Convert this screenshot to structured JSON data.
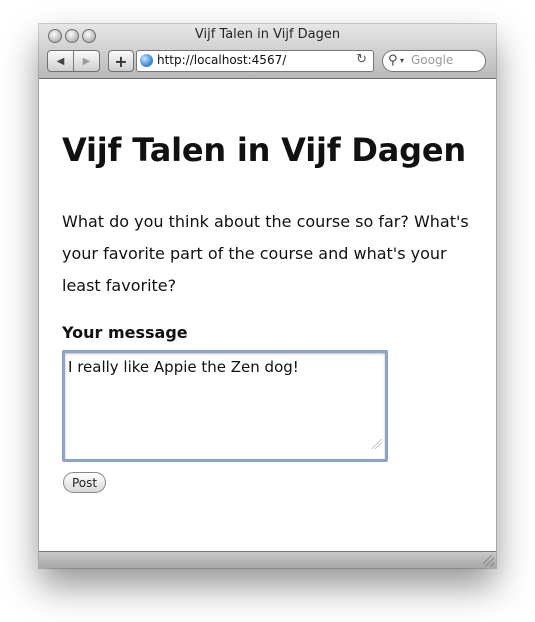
{
  "window": {
    "title": "Vijf Talen in Vijf Dagen"
  },
  "toolbar": {
    "back_icon": "◀",
    "forward_icon": "▶",
    "add_icon": "+",
    "url": "http://localhost:4567/",
    "reload_icon": "↻",
    "search_placeholder": "Google",
    "search_icon": "⚲",
    "search_caret": "▾"
  },
  "page": {
    "heading": "Vijf Talen in Vijf Dagen",
    "intro": "What do you think about the course so far? What's your favorite part of the course and what's your least favorite?",
    "message_label": "Your message",
    "message_value": "I really like Appie the Zen dog!",
    "post_label": "Post"
  }
}
